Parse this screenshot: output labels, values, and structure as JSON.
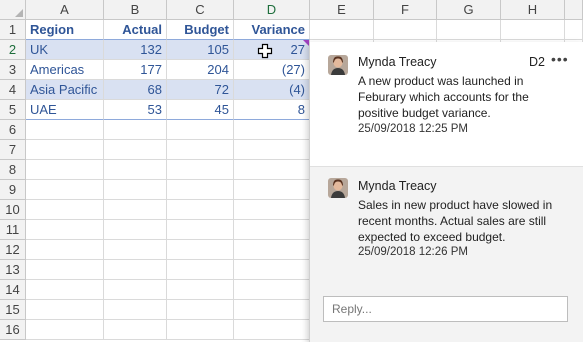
{
  "columns": [
    "A",
    "B",
    "C",
    "D",
    "E",
    "F",
    "G",
    "H"
  ],
  "rows": [
    "1",
    "2",
    "3",
    "4",
    "5",
    "6",
    "7",
    "8",
    "9",
    "10",
    "11",
    "12",
    "13",
    "14",
    "15",
    "16"
  ],
  "table": {
    "headers": [
      "Region",
      "Actual",
      "Budget",
      "Variance"
    ],
    "rows": [
      [
        "UK",
        "132",
        "105",
        "27"
      ],
      [
        "Americas",
        "177",
        "204",
        "(27)"
      ],
      [
        "Asia Pacific",
        "68",
        "72",
        "(4)"
      ],
      [
        "UAE",
        "53",
        "45",
        "8"
      ]
    ]
  },
  "comment_pane": {
    "cell_ref": "D2",
    "more_label": "•••",
    "reply_placeholder": "Reply...",
    "comments": [
      {
        "author": "Mynda Treacy",
        "text": "A new product was launched in Feburary which accounts for the positive budget variance.",
        "timestamp": "25/09/2018 12:25 PM"
      },
      {
        "author": "Mynda Treacy",
        "text": "Sales in new product have slowed in recent months. Actual sales are still expected to exceed budget.",
        "timestamp": "25/09/2018 12:26 PM"
      }
    ]
  },
  "colors": {
    "header_bg": "#f2f2f2",
    "band": "#d9e1f2",
    "text_blue": "#2f5597",
    "comment_indicator": "#a040c0"
  }
}
